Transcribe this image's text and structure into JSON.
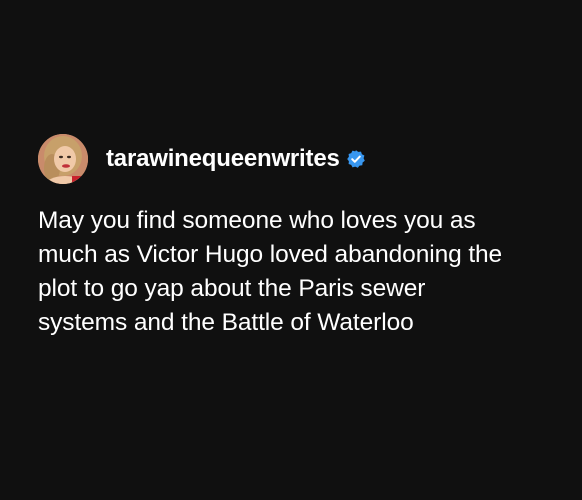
{
  "post": {
    "username": "tarawinequeenwrites",
    "verified": true,
    "text": "May you find someone who loves you as\nmuch as Victor Hugo loved abandoning the\nplot to go yap about the Paris sewer\nsystems and the Battle of Waterloo"
  },
  "colors": {
    "background": "#101010",
    "text": "#ffffff",
    "verified_badge": "#3897f0"
  },
  "icons": {
    "verified": "verified-badge-icon",
    "avatar": "profile-photo"
  }
}
